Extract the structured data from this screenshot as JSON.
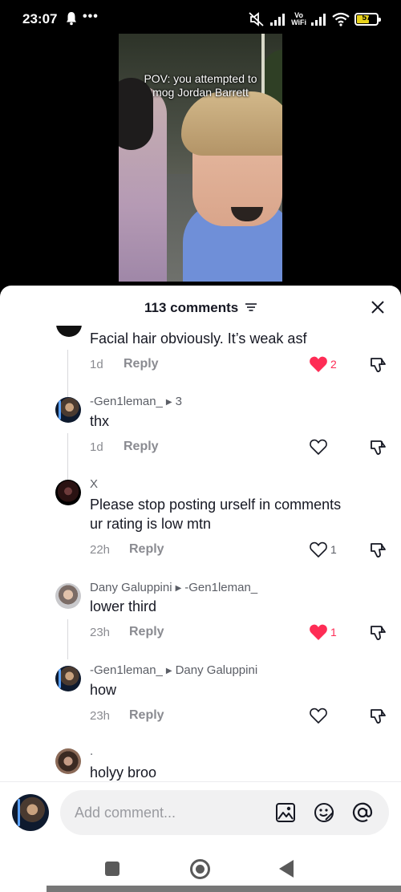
{
  "status_bar": {
    "time": "23:07",
    "dots": "•••",
    "vowifi_top": "Vo",
    "vowifi_bottom": "WiFi",
    "battery_level": "57",
    "battery_fraction": 0.57,
    "battery_color": "#e8d21a",
    "icons": [
      "bell-icon",
      "more-dots-icon",
      "mute-icon",
      "signal-icon",
      "vowifi-icon",
      "signal-icon",
      "wifi-icon",
      "battery-icon"
    ]
  },
  "video": {
    "caption_line1": "POV: you attempted to",
    "caption_line2": "mog Jordan Barrett"
  },
  "comments_panel": {
    "count_label": "113 comments",
    "filter_icon": "filter-icon",
    "close_icon": "close-icon",
    "comments": [
      {
        "text": "Facial hair obviously. It’s weak asf",
        "time": "1d",
        "reply_label": "Reply",
        "liked": true,
        "like_count": "2"
      },
      {
        "author": "-Gen1leman_",
        "reply_to": "3",
        "text": "thx",
        "time": "1d",
        "reply_label": "Reply",
        "liked": false,
        "like_count": ""
      },
      {
        "author": "X",
        "text_line1": "Please stop posting urself in comments",
        "text_line2": "ur rating is low mtn",
        "time": "22h",
        "reply_label": "Reply",
        "liked": false,
        "like_count": "1"
      },
      {
        "author": "Dany Galuppini",
        "reply_to": "-Gen1leman_",
        "text": "lower third",
        "time": "23h",
        "reply_label": "Reply",
        "liked": true,
        "like_count": "1"
      },
      {
        "author": "-Gen1leman_",
        "reply_to": "Dany Galuppini",
        "text": "how",
        "time": "23h",
        "reply_label": "Reply",
        "liked": false,
        "like_count": ""
      },
      {
        "author": ".",
        "text": "holyy broo"
      }
    ],
    "liked_color": "#fe2c55"
  },
  "composer": {
    "placeholder": "Add comment...",
    "icons": [
      "image-icon",
      "emoji-icon",
      "mention-icon"
    ]
  },
  "nav_bar": {
    "icons": [
      "recents-square-icon",
      "home-circle-icon",
      "back-triangle-icon"
    ]
  }
}
